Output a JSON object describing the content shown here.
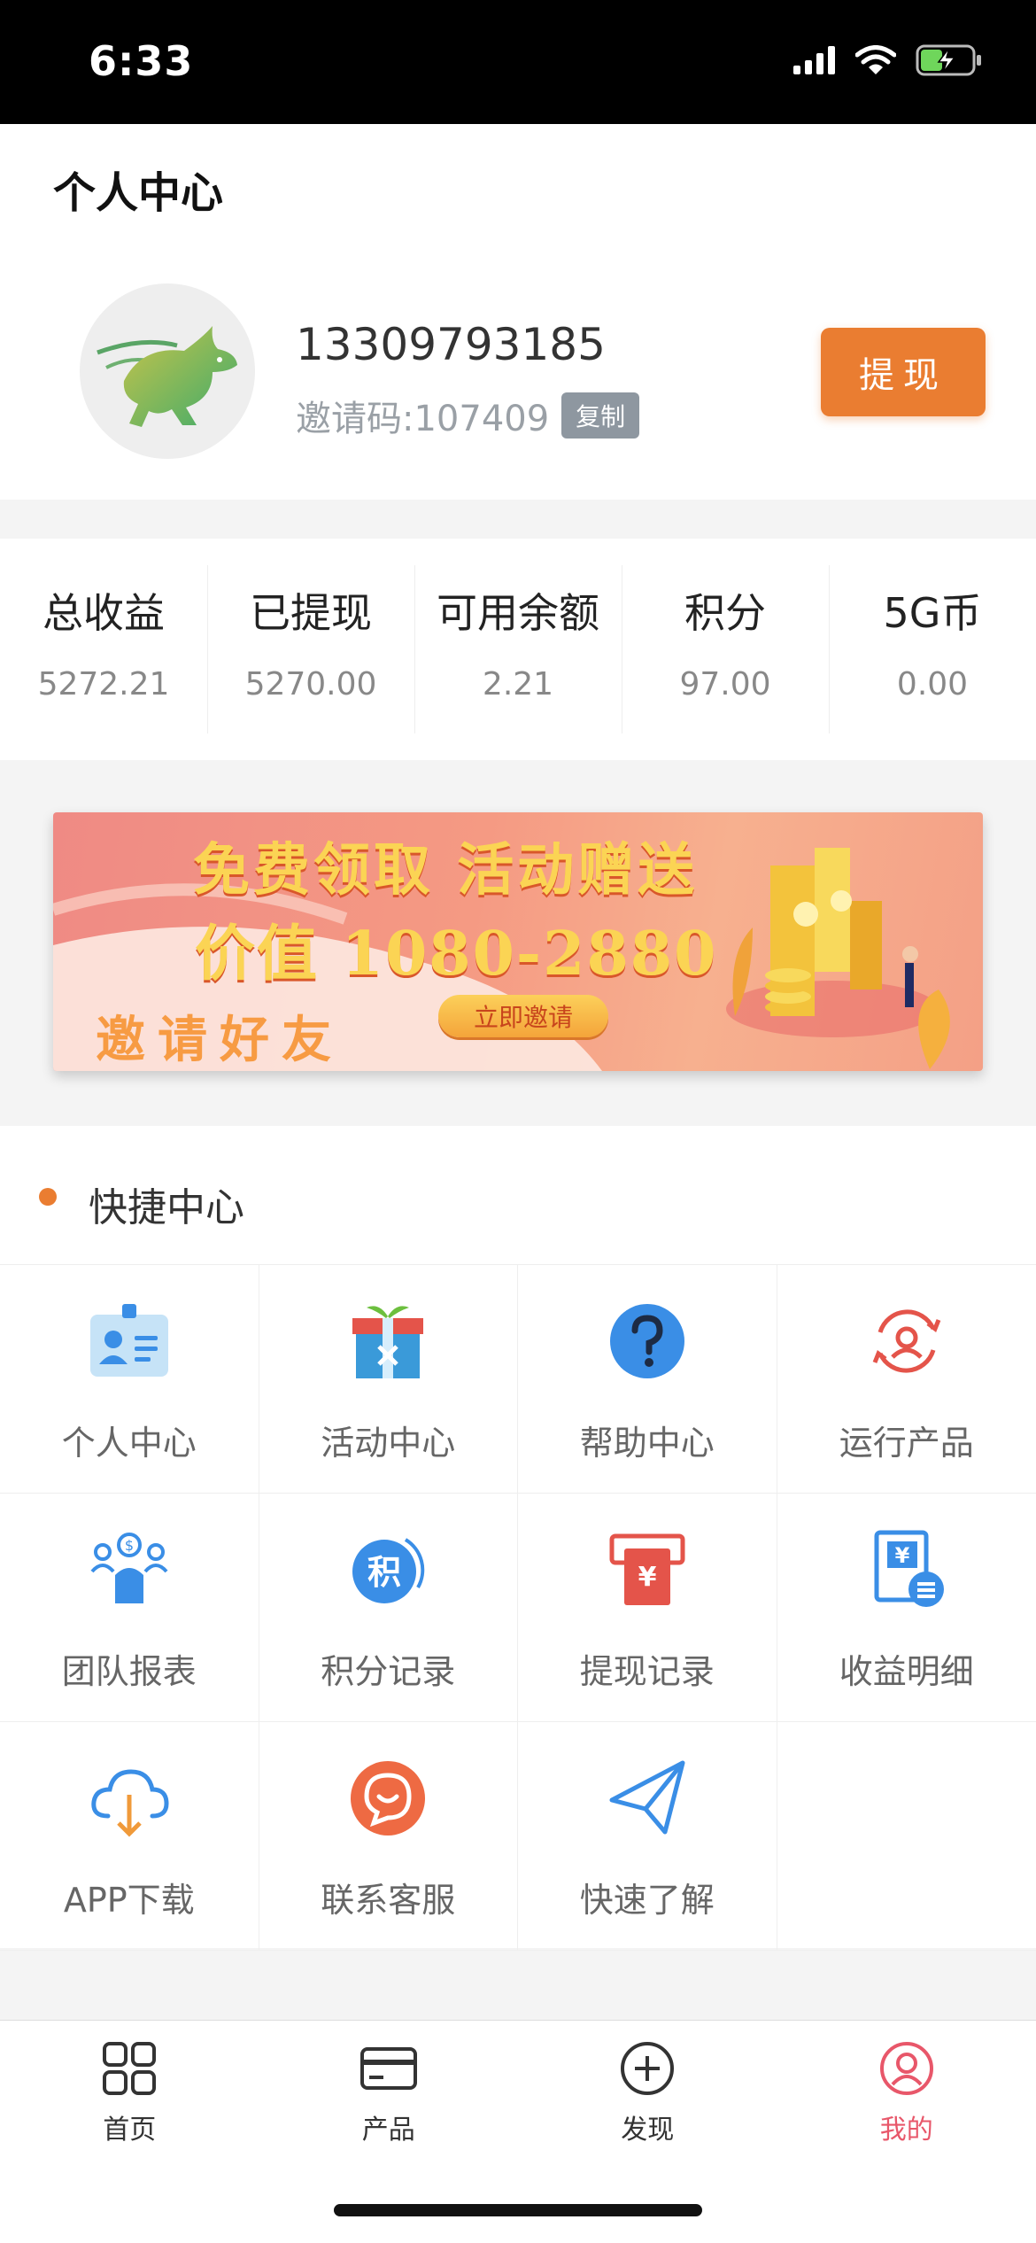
{
  "status_bar": {
    "time": "6:33"
  },
  "header": {
    "title": "个人中心",
    "phone": "13309793185",
    "invite_code": "邀请码:107409",
    "copy_label": "复制",
    "withdraw_label": "提现"
  },
  "stats": [
    {
      "label": "总收益",
      "value": "5272.21"
    },
    {
      "label": "已提现",
      "value": "5270.00"
    },
    {
      "label": "可用余额",
      "value": "2.21"
    },
    {
      "label": "积分",
      "value": "97.00"
    },
    {
      "label": "5G币",
      "value": "0.00"
    }
  ],
  "banner": {
    "line1": "免费领取 活动赠送",
    "line2": "价值 1080-2880",
    "line3": "邀请好友",
    "button": "立即邀请"
  },
  "quick": {
    "title": "快捷中心",
    "items": [
      {
        "label": "个人中心",
        "icon": "id-card-icon"
      },
      {
        "label": "活动中心",
        "icon": "gift-box-icon"
      },
      {
        "label": "帮助中心",
        "icon": "help-question-icon"
      },
      {
        "label": "运行产品",
        "icon": "running-product-icon"
      },
      {
        "label": "团队报表",
        "icon": "team-report-icon"
      },
      {
        "label": "积分记录",
        "icon": "points-record-icon"
      },
      {
        "label": "提现记录",
        "icon": "withdraw-record-icon"
      },
      {
        "label": "收益明细",
        "icon": "income-detail-icon"
      },
      {
        "label": "APP下载",
        "icon": "cloud-download-icon"
      },
      {
        "label": "联系客服",
        "icon": "customer-service-icon"
      },
      {
        "label": "快速了解",
        "icon": "paper-plane-icon"
      }
    ]
  },
  "tabs": [
    {
      "label": "首页",
      "icon": "grid-icon"
    },
    {
      "label": "产品",
      "icon": "card-icon"
    },
    {
      "label": "发现",
      "icon": "plus-circle-icon"
    },
    {
      "label": "我的",
      "icon": "user-circle-icon",
      "active": true
    }
  ],
  "colors": {
    "accent": "#ea7d31",
    "active_tab": "#e8576a",
    "info_blue": "#3a8ee6",
    "red_icon": "#e4544a"
  }
}
